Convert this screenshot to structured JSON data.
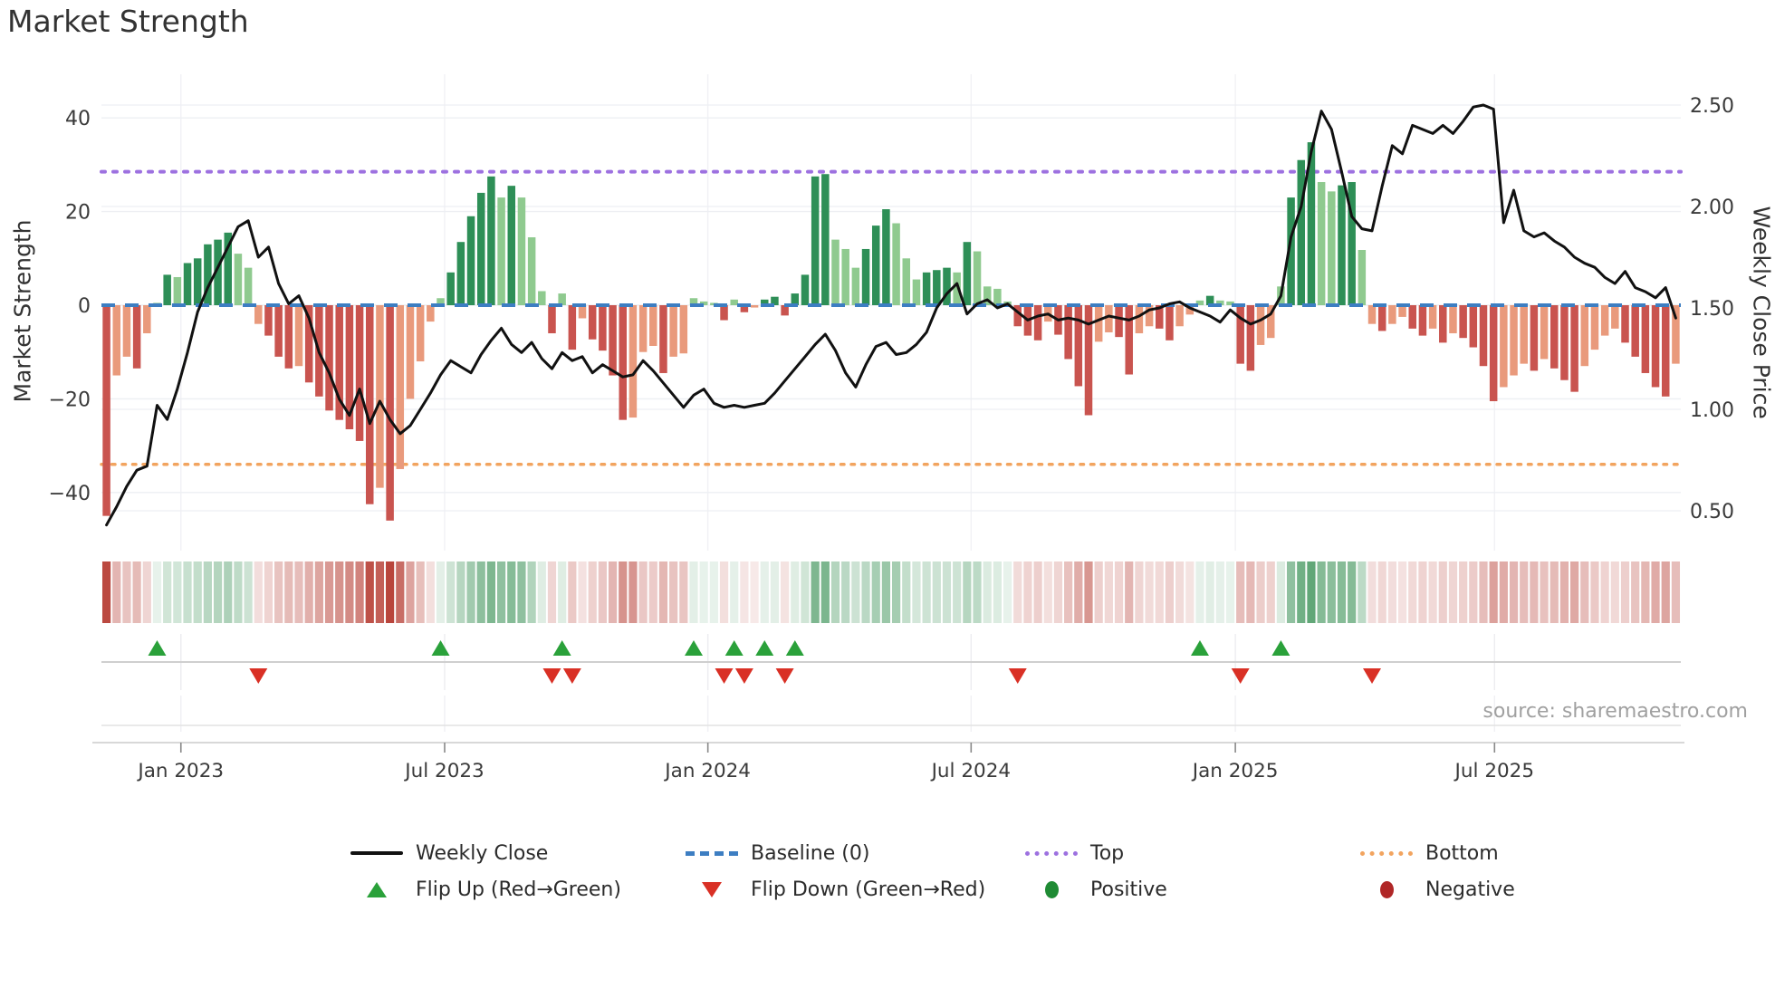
{
  "title": "Market Strength",
  "source_text": "source: sharemaestro.com",
  "left_axis": {
    "label": "Market Strength",
    "tick_labels": [
      "40",
      "20",
      "0",
      "−20",
      "−40"
    ],
    "tick_values": [
      40,
      20,
      0,
      -20,
      -40
    ]
  },
  "right_axis": {
    "label": "Weekly Close Price",
    "tick_labels": [
      "2.50",
      "2.00",
      "1.50",
      "1.00",
      "0.50"
    ],
    "tick_values": [
      2.5,
      2.0,
      1.5,
      1.0,
      0.5
    ]
  },
  "x_axis": {
    "tick_labels": [
      "Jan 2023",
      "Jul 2023",
      "Jan 2024",
      "Jul 2024",
      "Jan 2025",
      "Jul 2025"
    ],
    "tick_indices": [
      7.35,
      33.4,
      59.4,
      85.4,
      111.5,
      137.1
    ]
  },
  "legend": {
    "row1": [
      {
        "swatch": "solid-line",
        "label": "Weekly Close"
      },
      {
        "swatch": "dashed-line",
        "label": "Baseline (0)"
      },
      {
        "swatch": "dotted-line-purple",
        "label": "Top"
      },
      {
        "swatch": "dotted-line-orange",
        "label": "Bottom"
      }
    ],
    "row2": [
      {
        "swatch": "triangle-up",
        "label": "Flip Up (Red→Green)"
      },
      {
        "swatch": "triangle-down",
        "label": "Flip Down (Green→Red)"
      },
      {
        "swatch": "dot-green",
        "label": "Positive"
      },
      {
        "swatch": "dot-red",
        "label": "Negative"
      }
    ]
  },
  "colors": {
    "bar_positive_dark": "#2e8f57",
    "bar_positive_light": "#8fca8f",
    "bar_negative_dark": "#c9544f",
    "bar_negative_light": "#e99a7c",
    "price_line": "#111111",
    "baseline_line": "#3d7ec2",
    "top_line": "#9d71e0",
    "bottom_line": "#f2a45f",
    "flip_up_marker": "#2aa13a",
    "flip_down_marker": "#d93025",
    "positive_dot": "#1f8b34",
    "negative_dot": "#b02727",
    "heat_positive_rgb": "40,135,70",
    "heat_negative_rgb": "180,55,45",
    "grid": "#edeff3",
    "tick_text": "#3a3a3a"
  },
  "chart_data": {
    "type": "bar+line",
    "title": "Market Strength",
    "ylabel_left": "Market Strength",
    "ylabel_right": "Weekly Close Price",
    "n_weeks": 156,
    "baseline": 0,
    "top_level": 28.5,
    "bottom_level": -34,
    "left_ylim": [
      -52,
      49
    ],
    "right_ylim": [
      0.3,
      2.6
    ],
    "strength": [
      -45,
      -15,
      -11,
      -13.5,
      -6,
      0.5,
      6.5,
      6,
      9,
      10,
      13,
      14,
      15.5,
      11,
      8,
      -4,
      -6.5,
      -11,
      -13.5,
      -13,
      -16.5,
      -19.5,
      -22.5,
      -24.5,
      -26.5,
      -29,
      -42.5,
      -39,
      -46,
      -35,
      -20,
      -12,
      -3.5,
      1.5,
      7,
      13.5,
      19,
      24,
      27.5,
      23,
      25.5,
      23,
      14.5,
      3,
      -6,
      2.5,
      -9.5,
      -2.8,
      -7.3,
      -9.7,
      -15,
      -24.5,
      -24,
      -10,
      -8.7,
      -14.5,
      -11,
      -10.3,
      1.5,
      0.8,
      0.5,
      -3.2,
      1.2,
      -1.5,
      -0.5,
      1.2,
      1.8,
      -2.2,
      2.5,
      6.5,
      27.5,
      28,
      14,
      12,
      8,
      12,
      17,
      20.5,
      17.5,
      10,
      5.5,
      7,
      7.5,
      8,
      7,
      13.5,
      11.5,
      4,
      3.5,
      0.8,
      -4.5,
      -6.5,
      -7.5,
      -3.5,
      -6.3,
      -11.5,
      -17.3,
      -23.5,
      -7.8,
      -5.8,
      -6.8,
      -14.8,
      -6,
      -4.5,
      -5,
      -7.5,
      -4.5,
      -2,
      1,
      2,
      1,
      0.8,
      -12.5,
      -14,
      -8.5,
      -7,
      4,
      23,
      31,
      34.8,
      26.3,
      24.3,
      25.6,
      26.3,
      11.8,
      -4,
      -5.5,
      -4,
      -2.5,
      -5,
      -6.5,
      -5,
      -8,
      -6,
      -7,
      -9,
      -13,
      -20.5,
      -17.5,
      -15,
      -12.5,
      -14,
      -11.5,
      -13.5,
      -16,
      -18.5,
      -13,
      -9.5,
      -6.5,
      -5,
      -8,
      -11,
      -14.5,
      -17.5,
      -19.5,
      -12.5
    ],
    "weekly_close": [
      0.43,
      0.52,
      0.62,
      0.7,
      0.72,
      1.02,
      0.95,
      1.1,
      1.28,
      1.48,
      1.6,
      1.7,
      1.8,
      1.9,
      1.93,
      1.75,
      1.8,
      1.62,
      1.52,
      1.56,
      1.45,
      1.28,
      1.18,
      1.05,
      0.97,
      1.1,
      0.93,
      1.04,
      0.95,
      0.88,
      0.92,
      1.0,
      1.08,
      1.17,
      1.24,
      1.21,
      1.18,
      1.27,
      1.34,
      1.4,
      1.32,
      1.28,
      1.33,
      1.25,
      1.2,
      1.28,
      1.24,
      1.26,
      1.18,
      1.22,
      1.19,
      1.16,
      1.17,
      1.24,
      1.19,
      1.13,
      1.07,
      1.01,
      1.07,
      1.1,
      1.03,
      1.01,
      1.02,
      1.01,
      1.02,
      1.03,
      1.08,
      1.14,
      1.2,
      1.26,
      1.32,
      1.37,
      1.29,
      1.18,
      1.11,
      1.22,
      1.31,
      1.33,
      1.27,
      1.28,
      1.32,
      1.38,
      1.5,
      1.57,
      1.62,
      1.47,
      1.52,
      1.54,
      1.5,
      1.52,
      1.48,
      1.44,
      1.46,
      1.47,
      1.44,
      1.45,
      1.44,
      1.42,
      1.44,
      1.46,
      1.45,
      1.44,
      1.46,
      1.49,
      1.5,
      1.52,
      1.53,
      1.5,
      1.48,
      1.46,
      1.43,
      1.49,
      1.45,
      1.42,
      1.44,
      1.47,
      1.56,
      1.85,
      2.0,
      2.27,
      2.47,
      2.38,
      2.17,
      1.95,
      1.89,
      1.88,
      2.1,
      2.3,
      2.26,
      2.4,
      2.38,
      2.36,
      2.4,
      2.36,
      2.42,
      2.49,
      2.5,
      2.48,
      1.92,
      2.08,
      1.88,
      1.85,
      1.87,
      1.83,
      1.8,
      1.75,
      1.72,
      1.7,
      1.65,
      1.62,
      1.68,
      1.6,
      1.58,
      1.55,
      1.6,
      1.45
    ],
    "flip_up_indices": [
      5,
      33,
      45,
      58,
      62,
      65,
      68,
      108,
      116
    ],
    "flip_down_indices": [
      15,
      44,
      46,
      61,
      63,
      67,
      90,
      112,
      125
    ],
    "heatmap": "one cell per week, color = sign/magnitude of strength",
    "grid": "on",
    "legend_position": "bottom"
  }
}
